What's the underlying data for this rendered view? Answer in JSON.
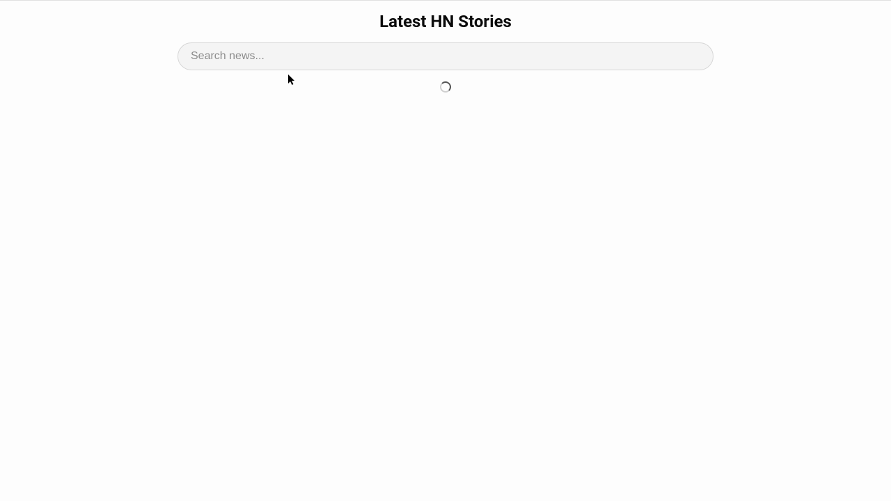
{
  "header": {
    "title": "Latest HN Stories"
  },
  "search": {
    "placeholder": "Search news...",
    "value": ""
  }
}
